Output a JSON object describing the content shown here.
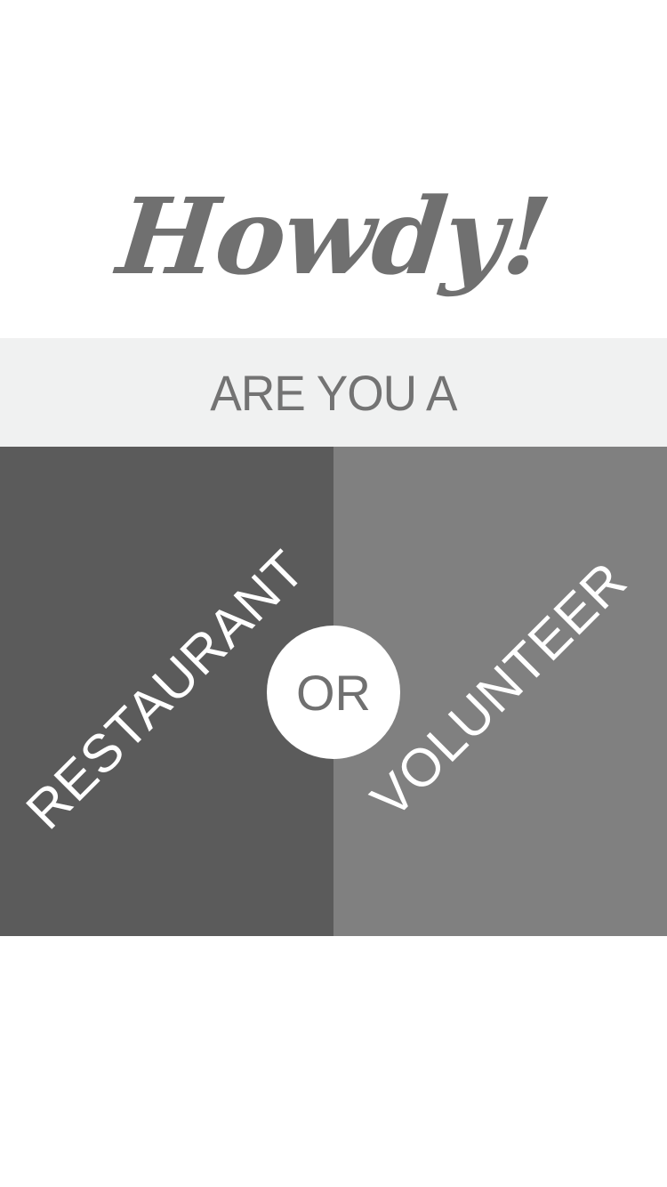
{
  "greeting": "Howdy!",
  "question": "ARE YOU A",
  "choices": {
    "restaurant": {
      "label": "RESTAURANT"
    },
    "volunteer": {
      "label": "VOLUNTEER"
    }
  },
  "separator": "OR",
  "colors": {
    "background": "#ffffff",
    "band": "#f0f1f1",
    "restaurant": "#5b5b5b",
    "volunteer": "#808080",
    "text_gray": "#737373",
    "label_white": "#ffffff"
  }
}
